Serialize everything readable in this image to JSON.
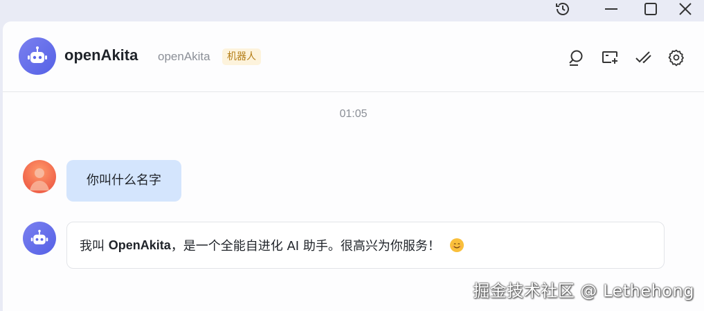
{
  "window": {
    "controls": [
      {
        "name": "history-icon"
      },
      {
        "name": "minimize-icon"
      },
      {
        "name": "maximize-icon"
      },
      {
        "name": "close-icon"
      }
    ]
  },
  "header": {
    "avatar_icon": "robot-icon",
    "title": "openAkita",
    "subtitle": "openAkita",
    "badge": "机器人",
    "actions": [
      "search-icon",
      "new-chat-icon",
      "check-icon",
      "settings-icon"
    ]
  },
  "chat": {
    "timestamp": "01:05",
    "messages": [
      {
        "role": "user",
        "text": "你叫什么名字"
      },
      {
        "role": "bot",
        "prefix": "我叫 ",
        "bold": "OpenAkita",
        "suffix": "，是一个全能自进化 AI 助手。很高兴为你服务！",
        "emoji": "smile-emoji"
      }
    ]
  },
  "watermark": "掘金技术社区 @ Lethehong",
  "colors": {
    "accent": "#5b66e8",
    "user_bubble": "#d4e5fd",
    "badge_bg": "#fdf3dc",
    "badge_text": "#b47d16"
  }
}
